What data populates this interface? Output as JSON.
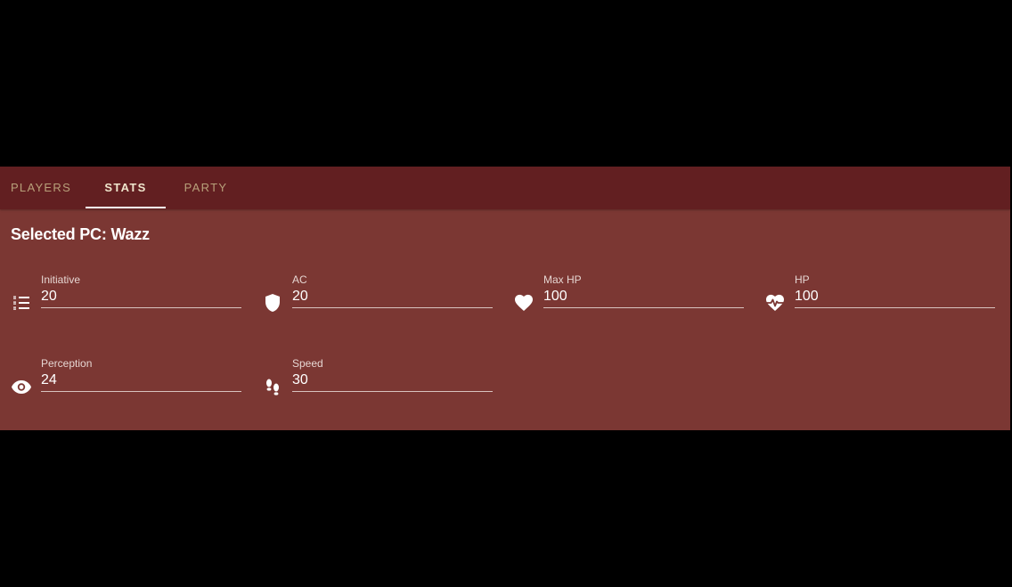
{
  "tabs": [
    {
      "label": "PLAYERS",
      "active": false
    },
    {
      "label": "STATS",
      "active": true
    },
    {
      "label": "PARTY",
      "active": false
    }
  ],
  "heading": "Selected PC: Wazz",
  "stats": {
    "initiative": {
      "label": "Initiative",
      "value": "20",
      "icon": "list-numbered-icon"
    },
    "ac": {
      "label": "AC",
      "value": "20",
      "icon": "shield-icon"
    },
    "max_hp": {
      "label": "Max HP",
      "value": "100",
      "icon": "heart-icon"
    },
    "hp": {
      "label": "HP",
      "value": "100",
      "icon": "heart-pulse-icon"
    },
    "perception": {
      "label": "Perception",
      "value": "24",
      "icon": "eye-icon"
    },
    "speed": {
      "label": "Speed",
      "value": "30",
      "icon": "footprints-icon"
    }
  },
  "colors": {
    "background": "#000000",
    "tabbar": "#621f21",
    "panel": "#7b3733",
    "tab_inactive_text": "#b8a07a",
    "tab_active_text": "#efe5cc",
    "indicator": "#ffffff",
    "text": "#ffffff"
  }
}
